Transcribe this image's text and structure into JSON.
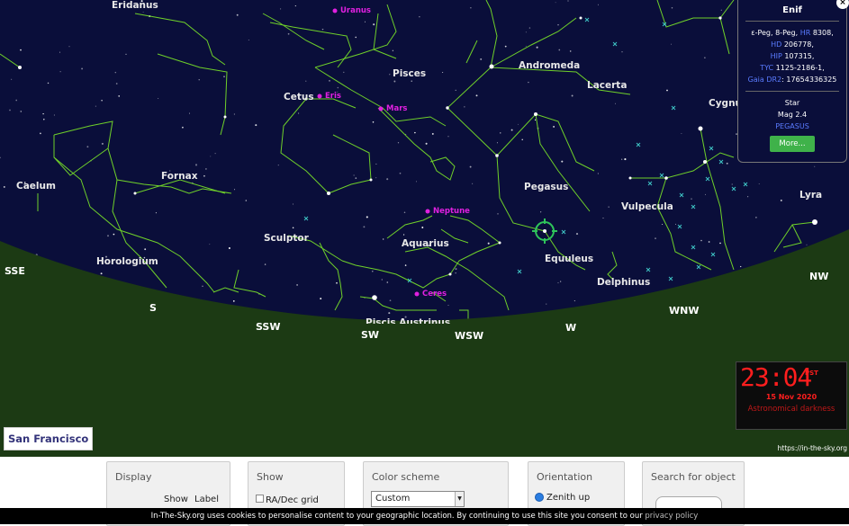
{
  "constellations": [
    "Eridanus",
    "Pisces",
    "Andromeda",
    "Lacerta",
    "Cygnus",
    "Cetus",
    "Fornax",
    "Caelum",
    "Pegasus",
    "Vulpecula",
    "Lyra",
    "Sculptor",
    "Aquarius",
    "Horologium",
    "Equuleus",
    "Delphinus",
    "Piscis Austrinus"
  ],
  "planets": [
    "Uranus",
    "Eris",
    "Mars",
    "Neptune",
    "Ceres"
  ],
  "compass": [
    "SSE",
    "S",
    "SSW",
    "SW",
    "WSW",
    "W",
    "WNW",
    "NW"
  ],
  "info": {
    "title": "Enif",
    "line1": "ε-Peg, 8-Peg,",
    "hr_label": "HR",
    "hr_value": "8308,",
    "hd_label": "HD",
    "hd_value": "206778,",
    "hip_label": "HIP",
    "hip_value": "107315,",
    "tyc_label": "TYC",
    "tyc_value": "1125-2186-1,",
    "gaia_label": "Gaia DR2",
    "gaia_value": "17654336325",
    "type": "Star",
    "mag": "Mag 2.4",
    "constellation": "PEGASUS",
    "more_label": "More...",
    "close": "×"
  },
  "clock": {
    "time": "23:04",
    "tz": "PST",
    "date": "15 Nov 2020",
    "status": "Astronomical darkness"
  },
  "location": "San Francisco",
  "site_url": "https://in-the-sky.org",
  "panels": {
    "display": {
      "title": "Display",
      "show": "Show",
      "label": "Label"
    },
    "show": {
      "title": "Show",
      "radec": "RA/Dec grid"
    },
    "color": {
      "title": "Color scheme",
      "value": "Custom"
    },
    "orientation": {
      "title": "Orientation",
      "zenith": "Zenith up"
    },
    "search": {
      "title": "Search for object"
    }
  },
  "cookie": {
    "text": "In-The-Sky.org uses cookies to personalise content to your geographic location. By continuing to use this site you consent to our",
    "link": "privacy policy"
  },
  "colors": {
    "sky": "#0a0e3a",
    "ground": "#1c3a14",
    "lines": "#6fd02a",
    "planet": "#e020e0",
    "clock": "#ff1e1e"
  }
}
